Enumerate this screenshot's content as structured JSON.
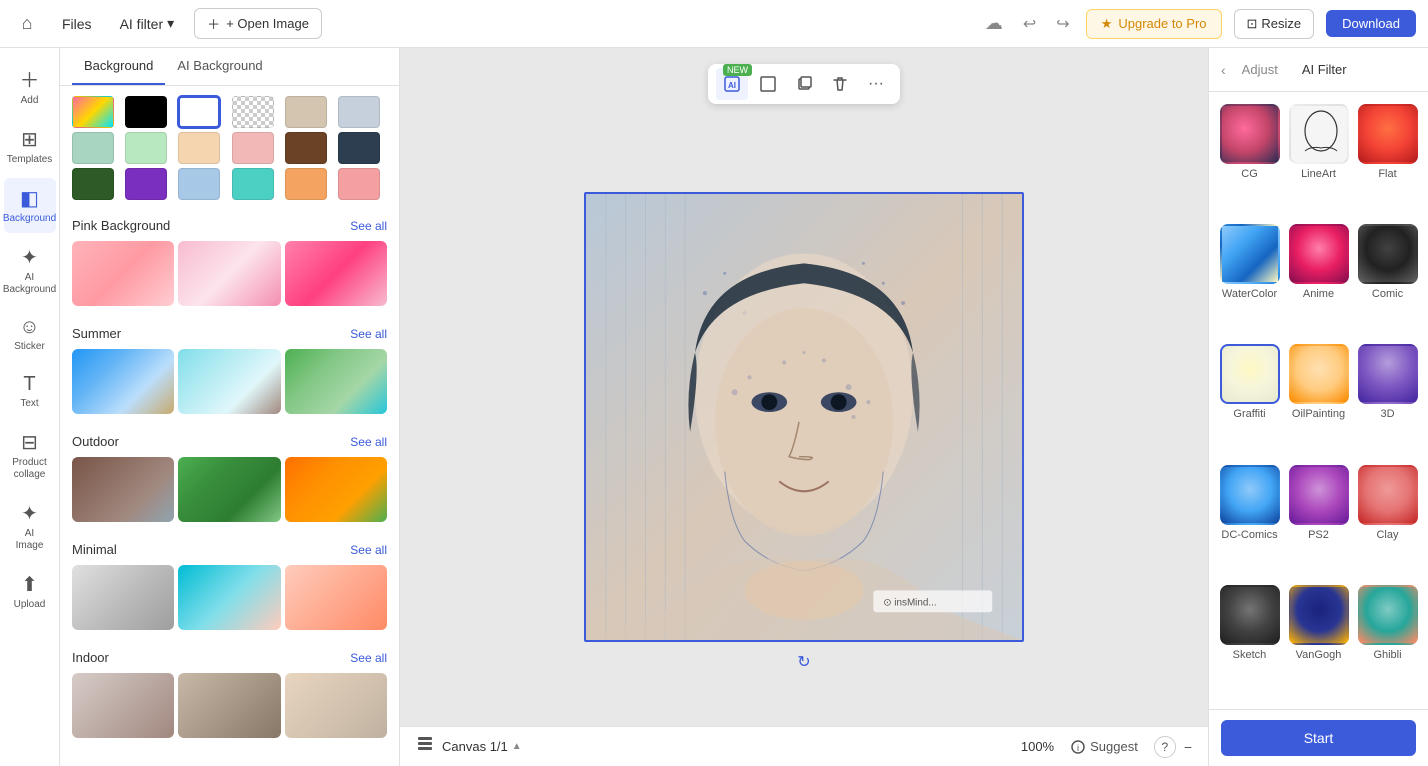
{
  "topbar": {
    "home_icon": "⌂",
    "files_label": "Files",
    "ai_filter_label": "AI filter",
    "ai_filter_arrow": "▾",
    "open_image_label": "+ Open Image",
    "sync_icon": "☁",
    "undo_icon": "↩",
    "redo_icon": "↪",
    "upgrade_icon": "★",
    "upgrade_label": "Upgrade to Pro",
    "resize_icon": "⊡",
    "resize_label": "Resize",
    "download_label": "Download"
  },
  "left_icons": [
    {
      "id": "add",
      "icon": "＋",
      "label": "Add"
    },
    {
      "id": "templates",
      "icon": "⊞",
      "label": "Templates"
    },
    {
      "id": "background",
      "icon": "◧",
      "label": "Background",
      "active": true
    },
    {
      "id": "ai_background",
      "icon": "✦",
      "label": "AI Background"
    },
    {
      "id": "sticker",
      "icon": "☺",
      "label": "Sticker"
    },
    {
      "id": "text",
      "icon": "T",
      "label": "Text"
    },
    {
      "id": "product_collage",
      "icon": "⊟",
      "label": "Product collage"
    },
    {
      "id": "ai_image",
      "icon": "✦",
      "label": "AI Image"
    },
    {
      "id": "upload",
      "icon": "⬆",
      "label": "Upload"
    }
  ],
  "panel": {
    "tabs": [
      {
        "id": "background",
        "label": "Background",
        "active": true
      },
      {
        "id": "ai_background",
        "label": "AI Background",
        "active": false
      }
    ],
    "swatches": [
      {
        "type": "gradient",
        "colors": [
          "#ff6b9d",
          "#ffd700",
          "#00e5ff"
        ],
        "selected": false
      },
      {
        "type": "solid",
        "color": "#000000",
        "selected": false
      },
      {
        "type": "solid",
        "color": "#ffffff",
        "selected": true
      },
      {
        "type": "checkered"
      },
      {
        "type": "solid",
        "color": "#d4c5b0",
        "selected": false
      },
      {
        "type": "solid",
        "color": "#c5d0dc",
        "selected": false
      },
      {
        "type": "solid",
        "color": "#a8d5c2",
        "selected": false
      },
      {
        "type": "solid",
        "color": "#b8e8c0",
        "selected": false
      },
      {
        "type": "solid",
        "color": "#f5d5b0",
        "selected": false
      },
      {
        "type": "solid",
        "color": "#f2b8b8",
        "selected": false
      },
      {
        "type": "solid",
        "color": "#6b4226",
        "selected": false
      },
      {
        "type": "solid",
        "color": "#2c3e50",
        "selected": false
      },
      {
        "type": "solid",
        "color": "#2d5a27",
        "selected": false
      },
      {
        "type": "solid",
        "color": "#7b2fbe",
        "selected": false
      },
      {
        "type": "solid",
        "color": "#a8c8e8",
        "selected": false
      },
      {
        "type": "solid",
        "color": "#4dd0c4",
        "selected": false
      },
      {
        "type": "solid",
        "color": "#f4a460",
        "selected": false
      },
      {
        "type": "solid",
        "color": "#f4a0a0",
        "selected": false
      }
    ],
    "sections": [
      {
        "id": "pink_background",
        "title": "Pink Background",
        "see_all": "See all",
        "thumbs": [
          "pink-bg-1",
          "pink-bg-2",
          "pink-bg-3"
        ]
      },
      {
        "id": "summer",
        "title": "Summer",
        "see_all": "See all",
        "thumbs": [
          "summer-1",
          "summer-2",
          "summer-3"
        ]
      },
      {
        "id": "outdoor",
        "title": "Outdoor",
        "see_all": "See all",
        "thumbs": [
          "outdoor-1",
          "outdoor-2",
          "outdoor-3"
        ]
      },
      {
        "id": "minimal",
        "title": "Minimal",
        "see_all": "See all",
        "thumbs": [
          "minimal-1",
          "minimal-2",
          "minimal-3"
        ]
      },
      {
        "id": "indoor",
        "title": "Indoor",
        "see_all": "See all",
        "thumbs": [
          "indoor-1",
          "indoor-1",
          "indoor-1"
        ]
      }
    ]
  },
  "canvas": {
    "canvas_label": "Canvas 1/1",
    "zoom": "100%",
    "suggest_label": "Suggest",
    "suggest_icon": "💡",
    "help_icon": "?",
    "watermark": "insMind...",
    "rotate_icon": "↻"
  },
  "right_panel": {
    "back_icon": "‹",
    "adjust_tab": "Adjust",
    "ai_filter_tab": "AI Filter",
    "active_tab": "ai_filter",
    "filters": [
      {
        "id": "cg",
        "label": "CG",
        "class": "ft-cg",
        "selected": false
      },
      {
        "id": "lineart",
        "label": "LineArt",
        "class": "ft-lineart",
        "selected": false
      },
      {
        "id": "flat",
        "label": "Flat",
        "class": "ft-flat",
        "selected": false
      },
      {
        "id": "watercolor",
        "label": "WaterColor",
        "class": "ft-watercolor",
        "selected": false
      },
      {
        "id": "anime",
        "label": "Anime",
        "class": "ft-anime",
        "selected": false
      },
      {
        "id": "comic",
        "label": "Comic",
        "class": "ft-comic",
        "selected": false
      },
      {
        "id": "graffiti",
        "label": "Graffiti",
        "class": "ft-graffiti",
        "selected": true
      },
      {
        "id": "oilpainting",
        "label": "OilPainting",
        "class": "ft-oilpainting",
        "selected": false
      },
      {
        "id": "3d",
        "label": "3D",
        "class": "ft-3d",
        "selected": false
      },
      {
        "id": "dccomics",
        "label": "DC-Comics",
        "class": "ft-dccomics",
        "selected": false
      },
      {
        "id": "ps2",
        "label": "PS2",
        "class": "ft-ps2",
        "selected": false
      },
      {
        "id": "clay",
        "label": "Clay",
        "class": "ft-clay",
        "selected": false
      },
      {
        "id": "sketch",
        "label": "Sketch",
        "class": "ft-sketch",
        "selected": false
      },
      {
        "id": "vangogh",
        "label": "VanGogh",
        "class": "ft-vangogh",
        "selected": false
      },
      {
        "id": "ghibli",
        "label": "Ghibli",
        "class": "ft-ghibli",
        "selected": false
      }
    ],
    "start_btn": "Start"
  }
}
